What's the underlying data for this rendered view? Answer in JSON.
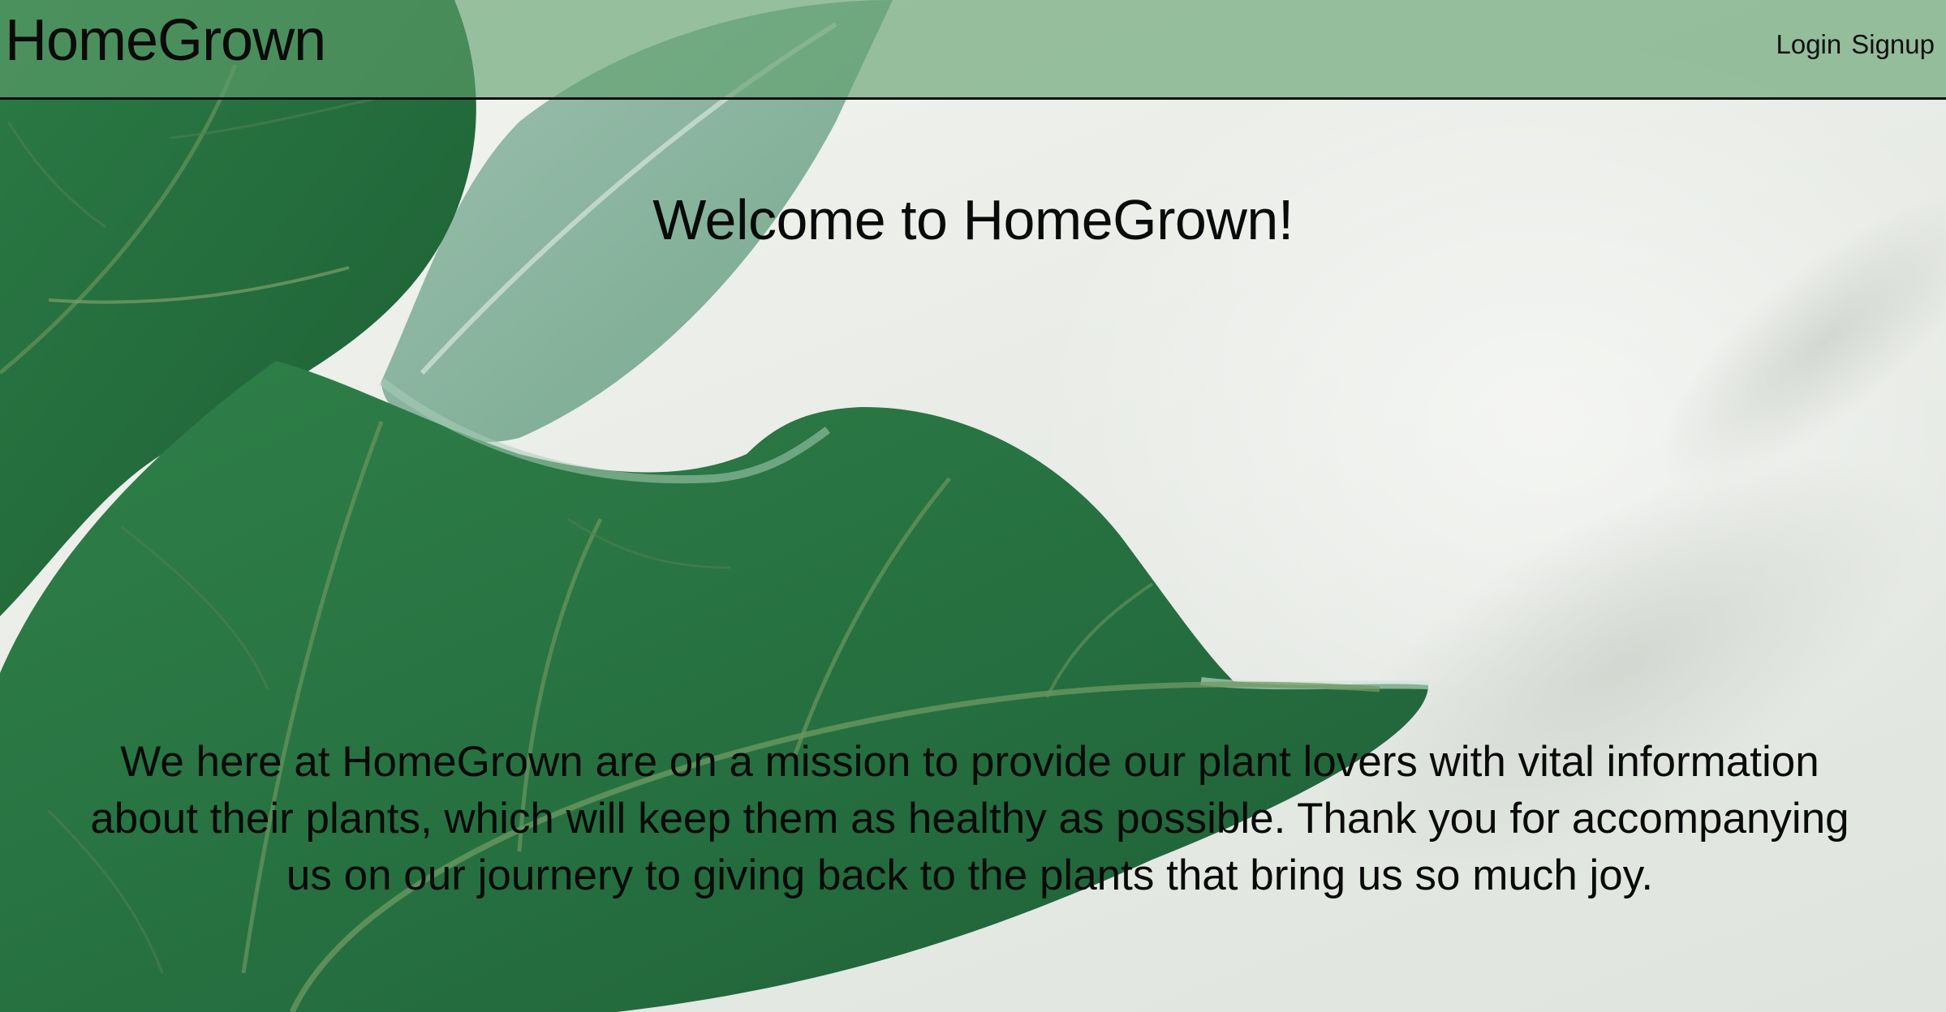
{
  "header": {
    "brand": "HomeGrown",
    "nav": [
      {
        "label": "Login"
      },
      {
        "label": "Signup"
      }
    ]
  },
  "hero": {
    "title": "Welcome to HomeGrown!",
    "mission": "We here at HomeGrown are on a mission to provide our plant lovers with vital information about their plants, which will keep them as healthy as possible. Thank you for accompanying us on our journery to giving back to the plants that bring us so much joy."
  },
  "theme": {
    "header_tint": "#60a06c",
    "leaf_dark": "#1f6b3c",
    "leaf_mid": "#2f7d48",
    "wall": "#eef0ec"
  },
  "background": {
    "icon": "fiddle-leaf-fig-photo"
  }
}
